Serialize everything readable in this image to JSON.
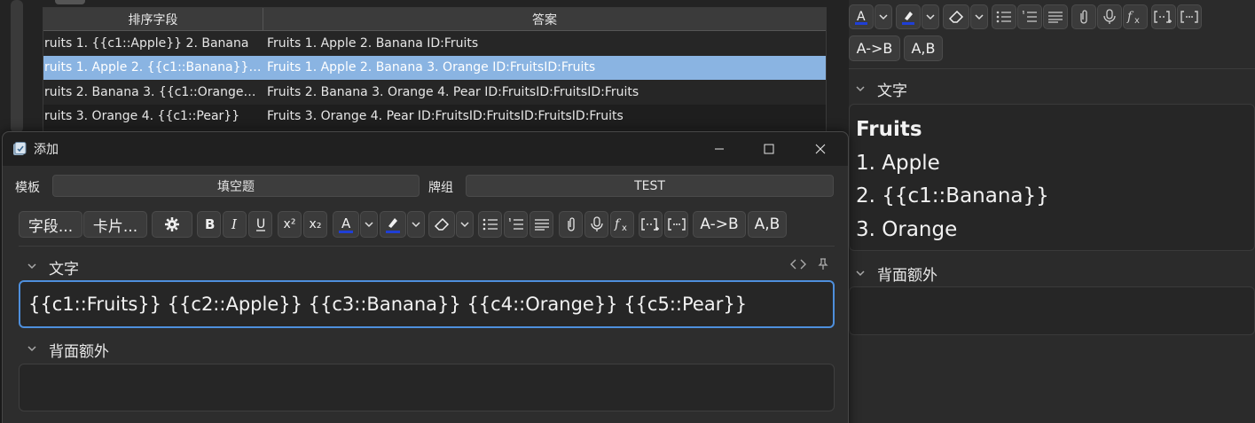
{
  "browser": {
    "columns": [
      "排序字段",
      "答案"
    ],
    "rows": [
      {
        "sort_field": "ruits 1. {{c1::Apple}} 2. Banana",
        "answer": "Fruits 1. Apple 2. Banana  ID:Fruits",
        "selected": false
      },
      {
        "sort_field": "ruits 1. Apple 2. {{c1::Banana}} 3. …",
        "answer": "Fruits 1. Apple 2. Banana 3. Orange  ID:FruitsID:Fruits",
        "selected": true
      },
      {
        "sort_field": "ruits 2. Banana 3. {{c1::Orange}} 4…",
        "answer": "Fruits 2. Banana 3. Orange 4. Pear  ID:FruitsID:FruitsID:Fruits",
        "selected": false
      },
      {
        "sort_field": "ruits 3. Orange 4. {{c1::Pear}}",
        "answer": "Fruits 3. Orange 4. Pear  ID:FruitsID:FruitsID:FruitsID:Fruits",
        "selected": false
      }
    ],
    "selected_row_color": "#8ab4e2"
  },
  "add_window": {
    "title": "添加",
    "note_type_label": "模板",
    "note_type_value": "填空题",
    "deck_label": "牌组",
    "deck_value": "TEST",
    "toolbar": {
      "fields_button": "字段...",
      "cards_button": "卡片...",
      "superscript_label": "x²",
      "subscript_label": "x₂",
      "cloze_button": "A->B",
      "ab_button": "A,B"
    },
    "fields": [
      {
        "name": "文字",
        "value": "{{c1::Fruits}} {{c2::Apple}} {{c3::Banana}} {{c4::Orange}} {{c5::Pear}}",
        "focused": true
      },
      {
        "name": "背面额外",
        "value": ""
      }
    ],
    "accent_color": "#4e8fdc"
  },
  "preview_panel": {
    "toolbar": {
      "cloze_button": "A->B",
      "ab_button": "A,B"
    },
    "fields": [
      {
        "name": "文字",
        "lines": [
          "Fruits",
          "1. Apple",
          "2. {{c1::Banana}}",
          "3. Orange"
        ]
      },
      {
        "name": "背面额外",
        "value": ""
      }
    ]
  }
}
